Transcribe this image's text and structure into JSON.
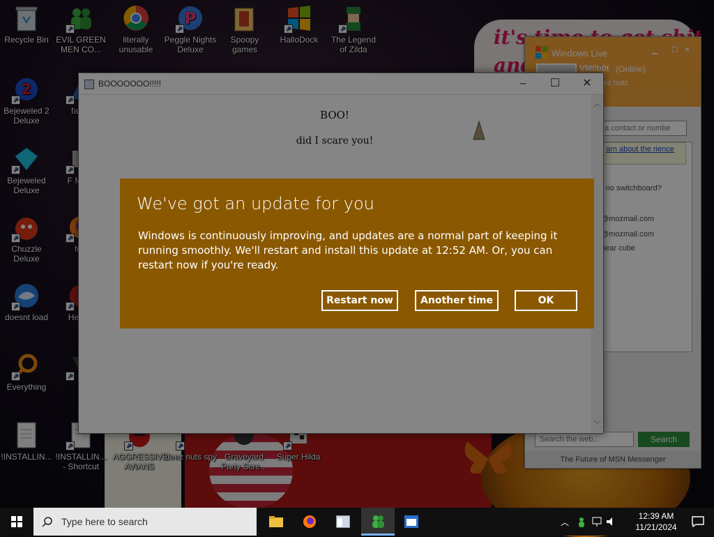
{
  "desktop": {
    "wallpaper_text": "it's time to get shit\nand",
    "icons": [
      {
        "label": "Recycle Bin",
        "icon": "recycle-bin-icon"
      },
      {
        "label": "EVIL GREEN MEN CO...",
        "icon": "msn-men-icon"
      },
      {
        "label": "literally unusable",
        "icon": "chrome-icon"
      },
      {
        "label": "Peggle Nights Deluxe",
        "icon": "peggle-icon"
      },
      {
        "label": "Spoopy games",
        "icon": "folder-icon"
      },
      {
        "label": "HalloDock",
        "icon": "windows-logo-icon"
      },
      {
        "label": "The Legend of Zilda",
        "icon": "zelda-icon"
      },
      {
        "label": "Bejeweled 2 Deluxe",
        "icon": "bejeweled2-icon"
      },
      {
        "label": "fat lik",
        "icon": "app-icon"
      },
      {
        "label": "Bejeweled Deluxe",
        "icon": "diamond-icon"
      },
      {
        "label": "F MON",
        "icon": "app-icon"
      },
      {
        "label": "Chuzzle Deluxe",
        "icon": "chuzzle-icon"
      },
      {
        "label": "furr",
        "icon": "firefox-icon"
      },
      {
        "label": "doesnt load",
        "icon": "thunderbird-icon"
      },
      {
        "label": "He We",
        "icon": "app-icon"
      },
      {
        "label": "Everything",
        "icon": "search-magnifier-icon"
      },
      {
        "label": "is",
        "icon": "app-icon"
      },
      {
        "label": "!INSTALLIN...",
        "icon": "document-icon"
      },
      {
        "label": "!INSTALLIN... - Shortcut",
        "icon": "document-icon"
      },
      {
        "label": "AGGRESSIVE AVIANS",
        "icon": "angry-birds-icon"
      },
      {
        "label": "deez nuts spy",
        "icon": "app-icon"
      },
      {
        "label": "Graveyard Party Scre...",
        "icon": "app-icon"
      },
      {
        "label": "Super Hilda",
        "icon": "app-icon"
      }
    ]
  },
  "msn": {
    "title": "Windows Live",
    "user": "VM0b0t",
    "status": "(Online)",
    "personal_message": "rate deez nuts",
    "search_contact_placeholder": "d a contact or numbe",
    "notice": "arn about the rience",
    "items": [
      "- no switchboard?",
      "@mozmail.com",
      "@mozmail.com",
      "bear cube"
    ],
    "web_search_placeholder": "Search the web...",
    "search_button": "Search",
    "footer": "The Future of MSN Messenger"
  },
  "boo_window": {
    "title": "BOOOOOOO!!!!!",
    "heading": "BOO!",
    "body": "did I scare you!",
    "minimize": "–",
    "maximize": "☐",
    "close": "✕"
  },
  "update_dialog": {
    "title": "We've got an update for you",
    "message": "Windows is continuously improving, and updates are a normal part of keeping it running smoothly. We'll restart and install this update at 12:52 AM. Or, you can restart now if you're ready.",
    "buttons": {
      "restart": "Restart now",
      "another": "Another time",
      "ok": "OK"
    },
    "bg_color": "#8a5800"
  },
  "taskbar": {
    "search_placeholder": "Type here to search",
    "time": "12:39 AM",
    "date": "11/21/2024"
  }
}
